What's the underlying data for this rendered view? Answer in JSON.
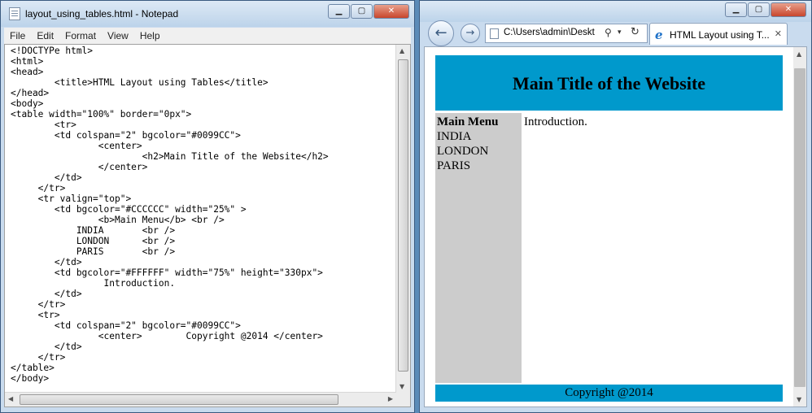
{
  "notepad": {
    "title": "layout_using_tables.html - Notepad",
    "menu": [
      "File",
      "Edit",
      "Format",
      "View",
      "Help"
    ],
    "code": "<!DOCTYPe html>\n<html>\n<head>\n        <title>HTML Layout using Tables</title>\n</head>\n<body>\n<table width=\"100%\" border=\"0px\">\n        <tr>\n        <td colspan=\"2\" bgcolor=\"#0099CC\">\n                <center>\n                        <h2>Main Title of the Website</h2>\n                </center>\n        </td>\n     </tr>\n     <tr valign=\"top\">\n        <td bgcolor=\"#CCCCCC\" width=\"25%\" >\n                <b>Main Menu</b> <br />\n            INDIA       <br />\n            LONDON      <br />\n            PARIS       <br />\n        </td>\n        <td bgcolor=\"#FFFFFF\" width=\"75%\" height=\"330px\">\n                 Introduction.\n        </td>\n     </tr>\n     <tr>\n        <td colspan=\"2\" bgcolor=\"#0099CC\">\n                <center>        Copyright @2014 </center>\n        </td>\n     </tr>\n</table>\n</body>"
  },
  "browser": {
    "address": "C:\\Users\\admin\\Deskt",
    "tab_title": "HTML Layout using T...",
    "page": {
      "heading": "Main Title of the Website",
      "menu_title": "Main Menu",
      "menu_items": [
        "INDIA",
        "LONDON",
        "PARIS"
      ],
      "intro": "Introduction.",
      "footer": "Copyright @2014"
    }
  },
  "colors": {
    "header_bg": "#0099CC",
    "sidebar_bg": "#CCCCCC",
    "main_bg": "#FFFFFF",
    "window_frame": "#c9dbee",
    "close_button": "#c8462c"
  },
  "icons": [
    "notepad-icon",
    "back-arrow-icon",
    "forward-arrow-icon",
    "page-icon",
    "search-icon",
    "dropdown-icon",
    "refresh-icon",
    "ie-icon",
    "close-icon",
    "minimize-icon",
    "maximize-icon"
  ]
}
